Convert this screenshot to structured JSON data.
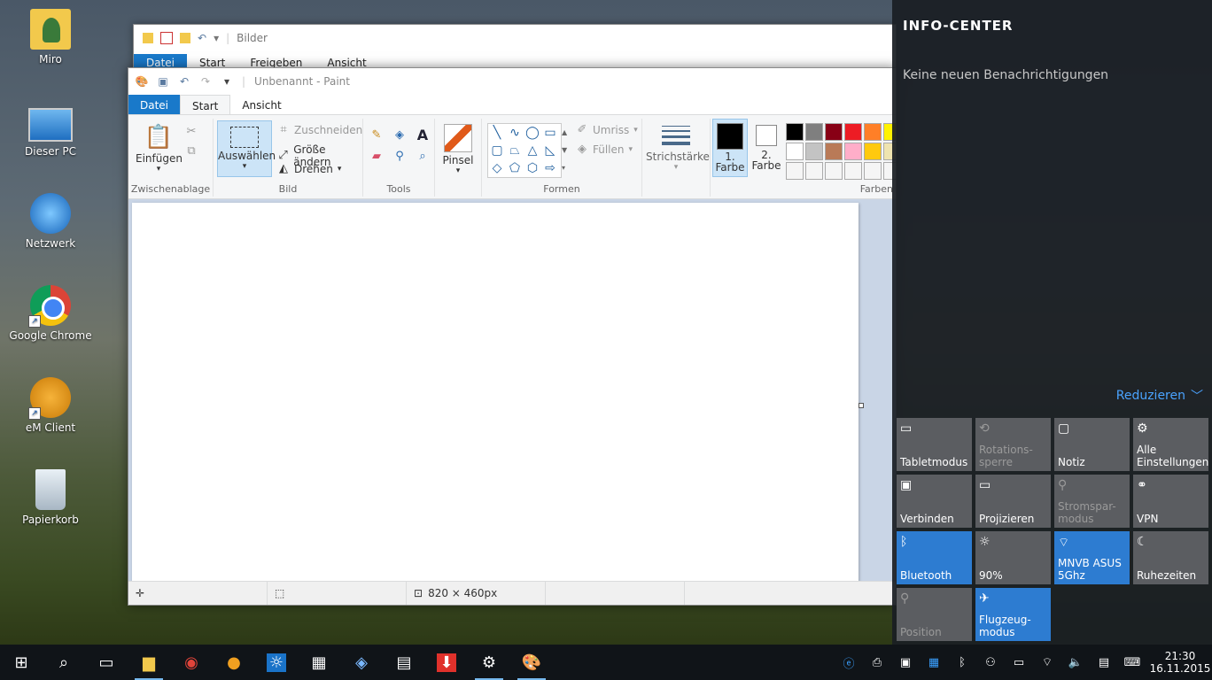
{
  "desktop": {
    "icons": [
      {
        "label": "Miro",
        "icon": "user-folder-icon"
      },
      {
        "label": "Dieser PC",
        "icon": "computer-icon"
      },
      {
        "label": "Netzwerk",
        "icon": "network-icon"
      },
      {
        "label": "Google Chrome",
        "icon": "chrome-icon"
      },
      {
        "label": "eM Client",
        "icon": "em-client-icon"
      },
      {
        "label": "Papierkorb",
        "icon": "recycle-bin-icon"
      }
    ]
  },
  "explorer": {
    "title": "Bilder",
    "tabs": [
      "Datei",
      "Start",
      "Freigeben",
      "Ansicht"
    ]
  },
  "paint": {
    "title": "Unbenannt - Paint",
    "tabs": [
      "Datei",
      "Start",
      "Ansicht"
    ],
    "groups": {
      "clipboard": {
        "label": "Zwischenablage",
        "paste": "Einfügen"
      },
      "image": {
        "label": "Bild",
        "select": "Auswählen",
        "crop": "Zuschneiden",
        "resize": "Größe ändern",
        "rotate": "Drehen"
      },
      "tools": {
        "label": "Tools"
      },
      "brushes": {
        "label": "Pinsel"
      },
      "shapes": {
        "label": "Formen",
        "outline": "Umriss",
        "fill": "Füllen"
      },
      "size": {
        "label": "Strichstärke"
      },
      "colors": {
        "label": "Farben",
        "color1": "1.\nFarbe",
        "color2": "2.\nFarbe"
      }
    },
    "palette": [
      "#000000",
      "#7f7f7f",
      "#880015",
      "#ed1c24",
      "#ff7f27",
      "#fff200",
      "#ffffff",
      "#c3c3c3",
      "#b97a57",
      "#ffaec9",
      "#ffc90e",
      "#efe4b0",
      "#f5f5f5",
      "#f5f5f5",
      "#f5f5f5",
      "#f5f5f5",
      "#f5f5f5",
      "#f5f5f5"
    ],
    "status": {
      "size": "820 × 460px"
    }
  },
  "action_center": {
    "title": "INFO-CENTER",
    "empty": "Keine neuen Benachrichtigungen",
    "collapse": "Reduzieren",
    "tiles": [
      {
        "label": "Tabletmodus",
        "state": "off",
        "icon": "tablet-icon"
      },
      {
        "label": "Rotations-\nsperre",
        "state": "disabled",
        "icon": "rotation-lock-icon"
      },
      {
        "label": "Notiz",
        "state": "off",
        "icon": "note-icon"
      },
      {
        "label": "Alle\nEinstellungen",
        "state": "off",
        "icon": "settings-icon"
      },
      {
        "label": "Verbinden",
        "state": "off",
        "icon": "connect-icon"
      },
      {
        "label": "Projizieren",
        "state": "off",
        "icon": "project-icon"
      },
      {
        "label": "Stromspar-\nmodus",
        "state": "disabled",
        "icon": "battery-saver-icon"
      },
      {
        "label": "VPN",
        "state": "off",
        "icon": "vpn-icon"
      },
      {
        "label": "Bluetooth",
        "state": "on",
        "icon": "bluetooth-icon"
      },
      {
        "label": "90%",
        "state": "off",
        "icon": "brightness-icon"
      },
      {
        "label": "MNVB ASUS\n5Ghz",
        "state": "on",
        "icon": "wifi-icon"
      },
      {
        "label": "Ruhezeiten",
        "state": "off",
        "icon": "quiet-hours-icon"
      },
      {
        "label": "Position",
        "state": "disabled",
        "icon": "location-icon"
      },
      {
        "label": "Flugzeug-\nmodus",
        "state": "on",
        "icon": "airplane-icon"
      }
    ]
  },
  "taskbar": {
    "clock": {
      "time": "21:30",
      "date": "16.11.2015"
    }
  }
}
